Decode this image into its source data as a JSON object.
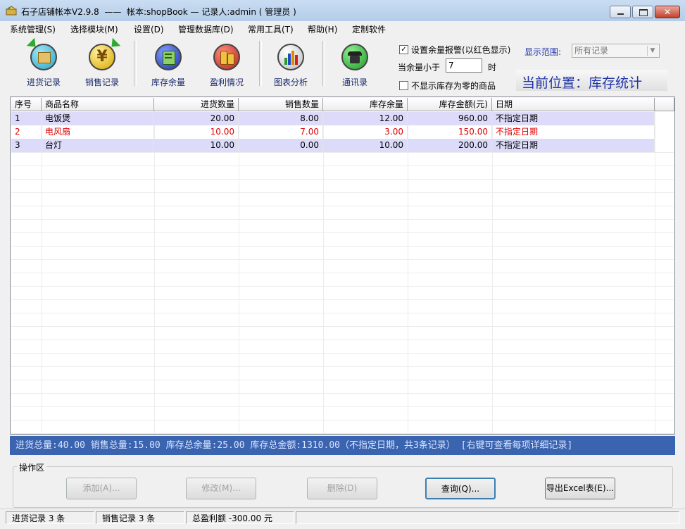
{
  "window": {
    "title": "石子店铺帐本V2.9.8  ——  帐本:shopBook — 记录人:admin ( 管理员 )"
  },
  "menu": [
    "系统管理(S)",
    "选择模块(M)",
    "设置(D)",
    "管理数据库(D)",
    "常用工具(T)",
    "帮助(H)",
    "定制软件"
  ],
  "toolbar": {
    "buttons": [
      {
        "label": "进货记录",
        "icon": "box-arrow-icon",
        "color": "#2aa7c9"
      },
      {
        "label": "销售记录",
        "icon": "yen-arrow-icon",
        "color": "#e6b800"
      },
      {
        "label": "库存余量",
        "icon": "inventory-icon",
        "color": "#2b48b8"
      },
      {
        "label": "盈利情况",
        "icon": "coins-icon",
        "color": "#b8261f"
      },
      {
        "label": "图表分析",
        "icon": "bar-chart-icon",
        "color": "#c9c9c9"
      },
      {
        "label": "通讯录",
        "icon": "telephone-icon",
        "color": "#1f9a2a"
      }
    ]
  },
  "options": {
    "alert_label": "设置余量报警(以红色显示)",
    "alert_checked": "✓",
    "threshold_prefix": "当余量小于",
    "threshold_value": "7",
    "threshold_suffix": "时",
    "hide_zero_label": "不显示库存为零的商品",
    "range_label": "显示范围:",
    "range_value": "所有记录",
    "position_text": "当前位置：库存统计"
  },
  "table": {
    "columns": [
      "序号",
      "商品名称",
      "进货数量",
      "销售数量",
      "库存余量",
      "库存金额(元)",
      "日期"
    ],
    "rows": [
      {
        "id": "1",
        "name": "电饭煲",
        "purchase": "20.00",
        "sold": "8.00",
        "stock": "12.00",
        "amount": "960.00",
        "date": "不指定日期",
        "alert": false
      },
      {
        "id": "2",
        "name": "电风扇",
        "purchase": "10.00",
        "sold": "7.00",
        "stock": "3.00",
        "amount": "150.00",
        "date": "不指定日期",
        "alert": true
      },
      {
        "id": "3",
        "name": "台灯",
        "purchase": "10.00",
        "sold": "0.00",
        "stock": "10.00",
        "amount": "200.00",
        "date": "不指定日期",
        "alert": false
      }
    ]
  },
  "summary": "进货总量:40.00  销售总量:15.00  库存总余量:25.00  库存总金额:1310.00（不指定日期，共3条记录）  [右键可查看每项详细记录]",
  "operations": {
    "label": "操作区",
    "add": "添加(A)...",
    "edit": "修改(M)...",
    "delete": "删除(D)",
    "query": "查询(Q)...",
    "export": "导出Excel表(E)..."
  },
  "status": {
    "purchase_count": "进货记录 3 条",
    "sales_count": "销售记录 3 条",
    "profit": "总盈利额 -300.00 元"
  },
  "colors": {
    "alert": "#e00000",
    "row_highlight": "#dcdcfa",
    "summary_bg": "#3a63b0",
    "position_text": "#1f33a8"
  }
}
